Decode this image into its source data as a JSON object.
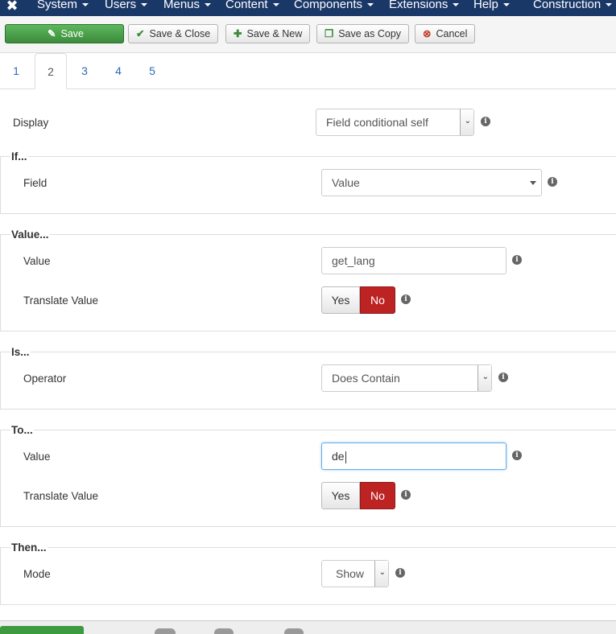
{
  "navbar": {
    "logo_icon": "joomla-logo-icon",
    "menus": [
      "System",
      "Users",
      "Menus",
      "Content",
      "Components",
      "Extensions",
      "Help",
      "Construction"
    ]
  },
  "toolbar": {
    "save": "Save",
    "save_close": "Save & Close",
    "save_new": "Save & New",
    "save_copy": "Save as Copy",
    "cancel": "Cancel"
  },
  "tabs": [
    "1",
    "2",
    "3",
    "4",
    "5"
  ],
  "form": {
    "display": {
      "label": "Display",
      "value": "Field conditional self"
    },
    "if": {
      "legend": "If...",
      "field_label": "Field",
      "field_value": "Value"
    },
    "value_section": {
      "legend": "Value...",
      "value_label": "Value",
      "value": "get_lang",
      "translate_label": "Translate Value",
      "yes": "Yes",
      "no": "No"
    },
    "is": {
      "legend": "Is...",
      "operator_label": "Operator",
      "operator_value": "Does Contain"
    },
    "to": {
      "legend": "To...",
      "value_label": "Value",
      "value": "de",
      "translate_label": "Translate Value",
      "yes": "Yes",
      "no": "No"
    },
    "then": {
      "legend": "Then...",
      "mode_label": "Mode",
      "mode_value": "Show"
    }
  },
  "colors": {
    "navbar": "#1a3867",
    "save_green": "#46a546",
    "toggle_no_red": "#bd2323",
    "link_blue": "#2a69b8"
  }
}
